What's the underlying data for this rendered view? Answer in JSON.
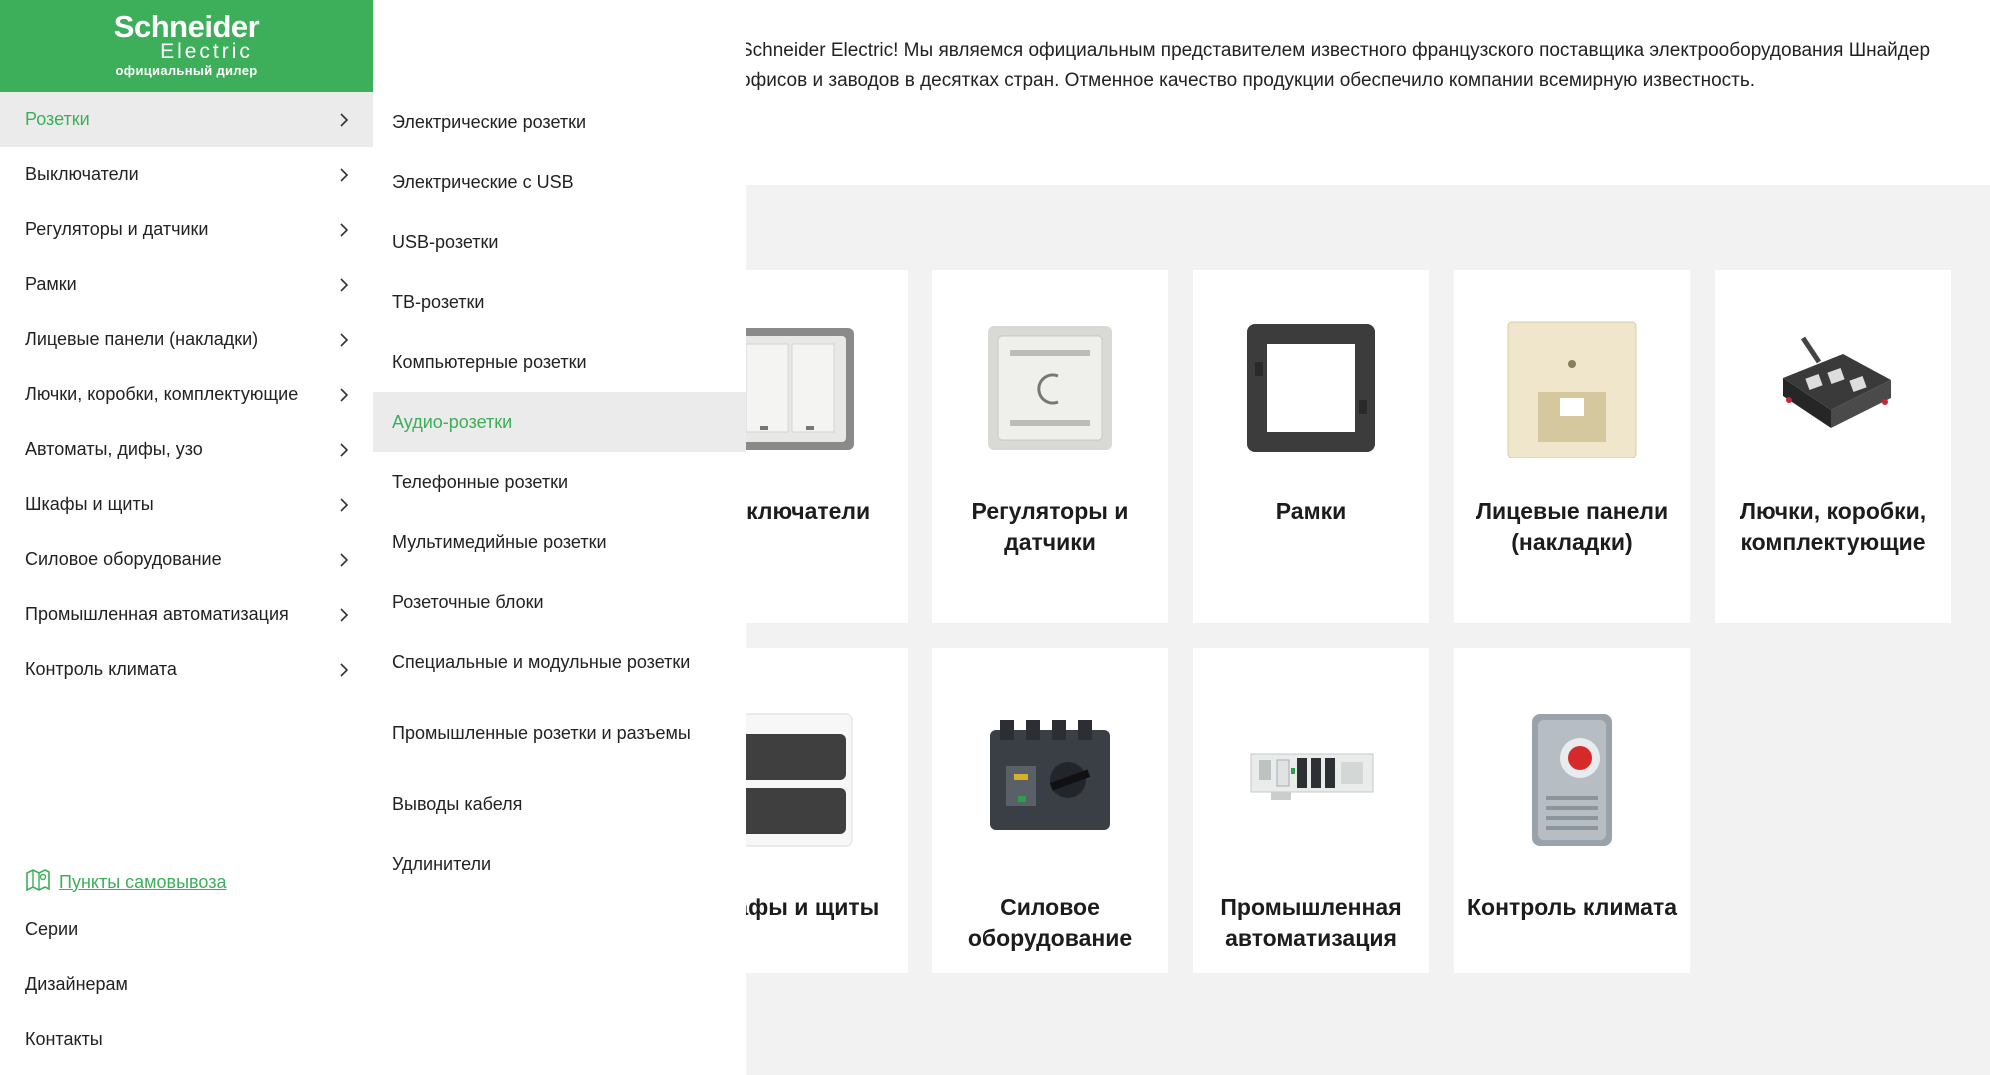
{
  "brand": {
    "name_line1": "Schneider",
    "name_line2": "Electric",
    "tagline": "официальный дилер",
    "color": "#3dae5a"
  },
  "intro": {
    "line1": "Schneider Electric! Мы являемся официальным представителем известного французского поставщика электрооборудования Шнайдер",
    "line2": "офисов и заводов в десятках стран. Отменное качество продукции обеспечило компании всемирную известность."
  },
  "sidebar": {
    "items": [
      {
        "label": "Розетки",
        "active": true
      },
      {
        "label": "Выключатели"
      },
      {
        "label": "Регуляторы и датчики"
      },
      {
        "label": "Рамки"
      },
      {
        "label": "Лицевые панели (накладки)"
      },
      {
        "label": "Лючки, коробки, комплектующие"
      },
      {
        "label": "Автоматы, дифы, узо"
      },
      {
        "label": "Шкафы и щиты"
      },
      {
        "label": "Силовое оборудование"
      },
      {
        "label": "Промышленная автоматизация"
      },
      {
        "label": "Контроль климата"
      }
    ],
    "pickup_label": "Пункты самовывоза",
    "bottom_items": [
      "Серии",
      "Дизайнерам",
      "Контакты"
    ]
  },
  "submenu": {
    "items": [
      "Электрические розетки",
      "Электрические с USB",
      "USB-розетки",
      "ТВ-розетки",
      "Компьютерные розетки",
      "Аудио-розетки",
      "Телефонные розетки",
      "Мультимедийные розетки",
      "Розеточные блоки",
      "Специальные и модульные розетки",
      "Промышленные розетки и разъемы",
      "Выводы кабеля",
      "Удлинители"
    ],
    "active_index": 5
  },
  "cards": {
    "row1": [
      {
        "label": "Выключатели",
        "icon": "switch-icon"
      },
      {
        "label": "Регуляторы и датчики",
        "icon": "thermostat-icon"
      },
      {
        "label": "Рамки",
        "icon": "frame-icon"
      },
      {
        "label": "Лицевые панели (накладки)",
        "icon": "face-plate-icon"
      },
      {
        "label": "Лючки, коробки, комплектующие",
        "icon": "floor-box-icon"
      }
    ],
    "row2": [
      {
        "label": "Шкафы и щиты",
        "icon": "cabinet-icon"
      },
      {
        "label": "Силовое оборудование",
        "icon": "power-switch-icon"
      },
      {
        "label": "Промышленная автоматизация",
        "icon": "plc-icon"
      },
      {
        "label": "Контроль климата",
        "icon": "climate-thermostat-icon"
      }
    ]
  },
  "colors": {
    "accent": "#3dae5a",
    "active_bg": "#ebebeb",
    "page_bg": "#f2f2f2"
  }
}
